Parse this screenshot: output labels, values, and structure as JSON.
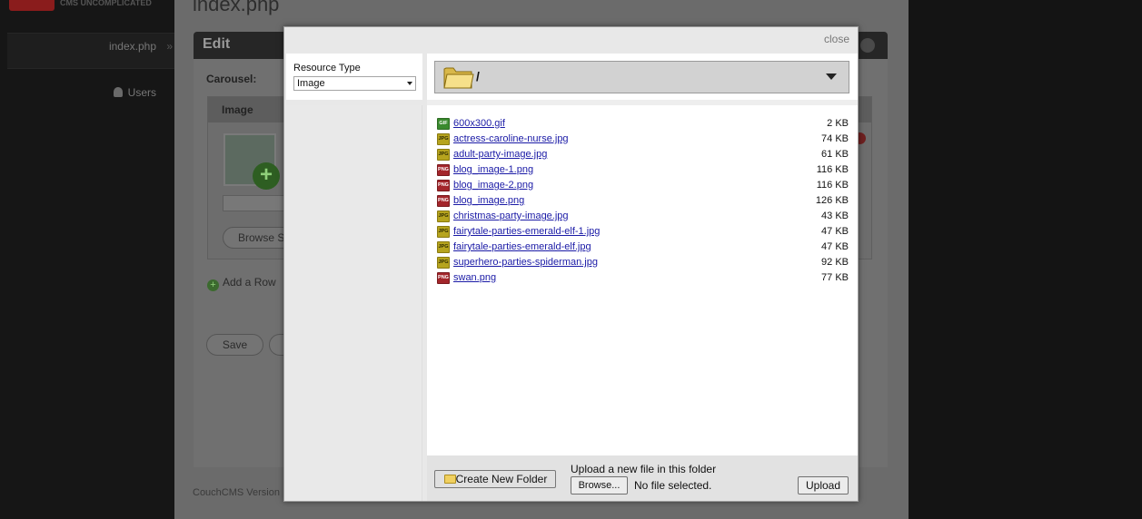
{
  "background": {
    "tagline": "CMS UNCOMPLICATED",
    "page_heading": "index.php",
    "nav": {
      "index_label": "index.php",
      "index_arrow": "»",
      "users_label": "Users"
    },
    "edit_title": "Edit",
    "carousel_label": "Carousel:",
    "image_col_header": "Image",
    "browse_label": "Browse S",
    "add_row_label": "Add a Row",
    "save_label": "Save",
    "version_text": "CouchCMS Version"
  },
  "modal": {
    "close_label": "close",
    "resource_type_label": "Resource Type",
    "resource_type_value": "Image",
    "current_folder": "/",
    "files": [
      {
        "name": "600x300.gif",
        "type": "GIF",
        "size": "2 KB"
      },
      {
        "name": "actress-caroline-nurse.jpg",
        "type": "JPG",
        "size": "74 KB"
      },
      {
        "name": "adult-party-image.jpg",
        "type": "JPG",
        "size": "61 KB"
      },
      {
        "name": "blog_image-1.png",
        "type": "PNG",
        "size": "116 KB"
      },
      {
        "name": "blog_image-2.png",
        "type": "PNG",
        "size": "116 KB"
      },
      {
        "name": "blog_image.png",
        "type": "PNG",
        "size": "126 KB"
      },
      {
        "name": "christmas-party-image.jpg",
        "type": "JPG",
        "size": "43 KB"
      },
      {
        "name": "fairytale-parties-emerald-elf-1.jpg",
        "type": "JPG",
        "size": "47 KB"
      },
      {
        "name": "fairytale-parties-emerald-elf.jpg",
        "type": "JPG",
        "size": "47 KB"
      },
      {
        "name": "superhero-parties-spiderman.jpg",
        "type": "JPG",
        "size": "92 KB"
      },
      {
        "name": "swan.png",
        "type": "PNG",
        "size": "77 KB"
      }
    ],
    "create_folder_label": "Create New Folder",
    "upload_prompt": "Upload a new file in this folder",
    "browse_label": "Browse...",
    "no_file_text": "No file selected.",
    "upload_label": "Upload"
  }
}
